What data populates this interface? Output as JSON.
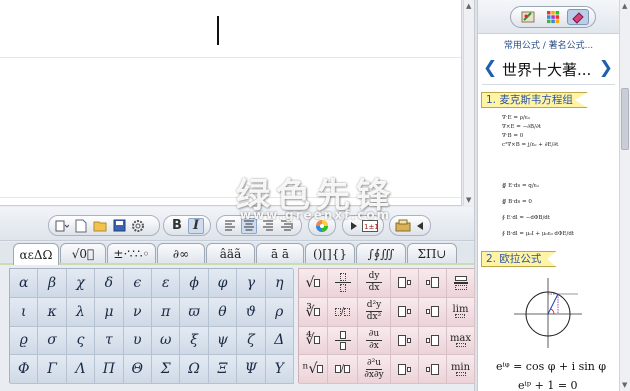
{
  "toolbar": {
    "bold_label": "B",
    "italic_label": "I"
  },
  "symbol_tabs": [
    "αεΔΩ",
    "√0⃞",
    "±·∵∴◦",
    "∂∞",
    "âäã",
    "ā ā",
    "()[]{}",
    "∫∮∭",
    "ΣΠ∪"
  ],
  "greek_symbols": [
    [
      "α",
      "β",
      "χ",
      "δ",
      "ϵ",
      "ε",
      "ϕ",
      "φ",
      "γ",
      "η"
    ],
    [
      "ι",
      "κ",
      "λ",
      "μ",
      "ν",
      "π",
      "ϖ",
      "θ",
      "ϑ",
      "ρ"
    ],
    [
      "ϱ",
      "σ",
      "ς",
      "τ",
      "υ",
      "ω",
      "ξ",
      "ψ",
      "ζ",
      "Δ"
    ],
    [
      "Φ",
      "Γ",
      "Λ",
      "Π",
      "Θ",
      "Σ",
      "Ω",
      "Ξ",
      "Ψ",
      "Υ"
    ]
  ],
  "templates": {
    "roots": [
      "√",
      "∛",
      "∜",
      "ⁿ√"
    ],
    "derivatives": [
      {
        "num": "dy",
        "den": "dx"
      },
      {
        "num": "d²y",
        "den": "dx²"
      },
      {
        "num": "∂u",
        "den": "∂x"
      },
      {
        "num": "∂²u",
        "den": "∂x∂y"
      }
    ],
    "limits": [
      "",
      "lim",
      "max",
      "min"
    ]
  },
  "right_panel": {
    "tab_icons": [
      "brush-icon",
      "grid-icon",
      "eraser-icon"
    ],
    "breadcrumb": "常用公式 / 著名公式...",
    "title": "世界十大著...",
    "prev_arrow": "❮",
    "next_arrow": "❯",
    "sections": [
      {
        "label": "1. 麦克斯韦方程组"
      },
      {
        "label": "2. 欧拉公式"
      }
    ],
    "maxwell_lines_1": [
      "∇·E = ρ/ε₀",
      "∇×E = −∂B/∂t",
      "∇·B = 0",
      "c²∇×B = j/ε₀ + ∂E/∂t"
    ],
    "maxwell_lines_2": [
      "∯ E·ds = q/ε₀",
      "∯ B·ds = 0",
      "∮ E·dl = −dΦB/dt",
      "∮ B·dl = μ₀I + μ₀ε₀ dΦE/dt"
    ],
    "euler_1": "e^{iφ} = cos φ + i sin φ",
    "euler_1_display": "eⁱᵠ = cos φ + i sin φ",
    "euler_2_display": "eⁱᵖ + 1 = 0"
  },
  "watermark": {
    "logo_text": "绿色先锋",
    "url": "www.greenxf.com"
  },
  "colors": {
    "accent_blue": "#1f5fae",
    "section_label_bg": "#fff3a6",
    "palette_blue": "#cdd8e6",
    "palette_pink": "#f2dfe3"
  }
}
